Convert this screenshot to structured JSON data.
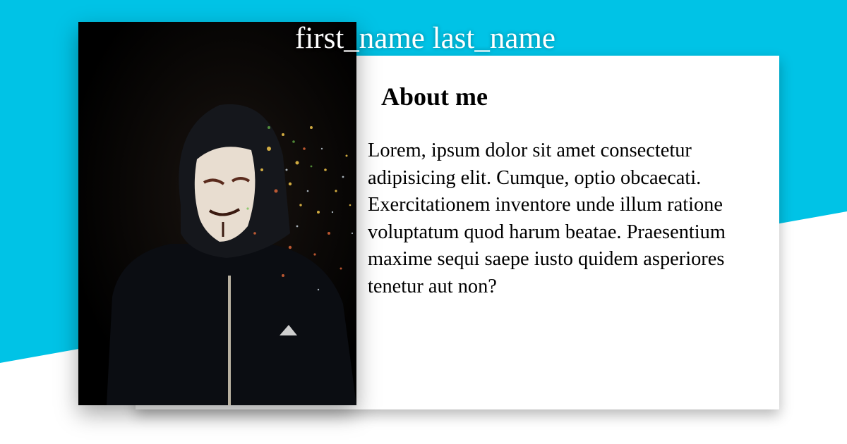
{
  "profile": {
    "name": "first_name last_name",
    "photo_alt": "hooded figure in Guy Fawkes mask dissolving into colorful particles"
  },
  "about": {
    "heading": "About me",
    "text": "Lorem, ipsum dolor sit amet consectetur adipisicing elit. Cumque, optio obcaecati. Exercitationem inventore unde illum ratione voluptatum quod harum beatae. Praesentium maxime sequi saepe iusto quidem asperiores tenetur aut non?"
  },
  "colors": {
    "accent": "#00c3e6",
    "card": "#ffffff",
    "text": "#000000",
    "name_text": "#ffffff"
  }
}
